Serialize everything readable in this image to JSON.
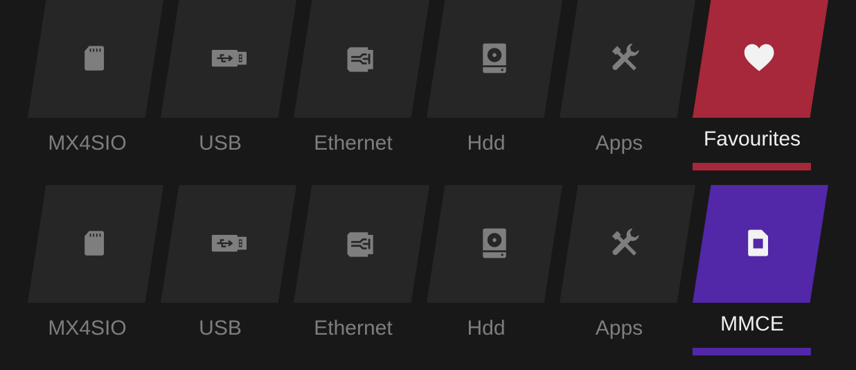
{
  "rows": [
    {
      "items": [
        {
          "label": "MX4SIO",
          "icon": "sd-card-icon"
        },
        {
          "label": "USB",
          "icon": "usb-drive-icon"
        },
        {
          "label": "Ethernet",
          "icon": "ethernet-icon"
        },
        {
          "label": "Hdd",
          "icon": "hdd-icon"
        },
        {
          "label": "Apps",
          "icon": "tools-icon"
        },
        {
          "label": "Favourites",
          "icon": "heart-icon",
          "selected": true,
          "color": "#a6283a"
        }
      ]
    },
    {
      "items": [
        {
          "label": "MX4SIO",
          "icon": "sd-card-icon"
        },
        {
          "label": "USB",
          "icon": "usb-drive-icon"
        },
        {
          "label": "Ethernet",
          "icon": "ethernet-icon"
        },
        {
          "label": "Hdd",
          "icon": "hdd-icon"
        },
        {
          "label": "Apps",
          "icon": "tools-icon"
        },
        {
          "label": "MMCE",
          "icon": "memory-card-icon",
          "selected": true,
          "color": "#5227a8"
        }
      ]
    }
  ]
}
